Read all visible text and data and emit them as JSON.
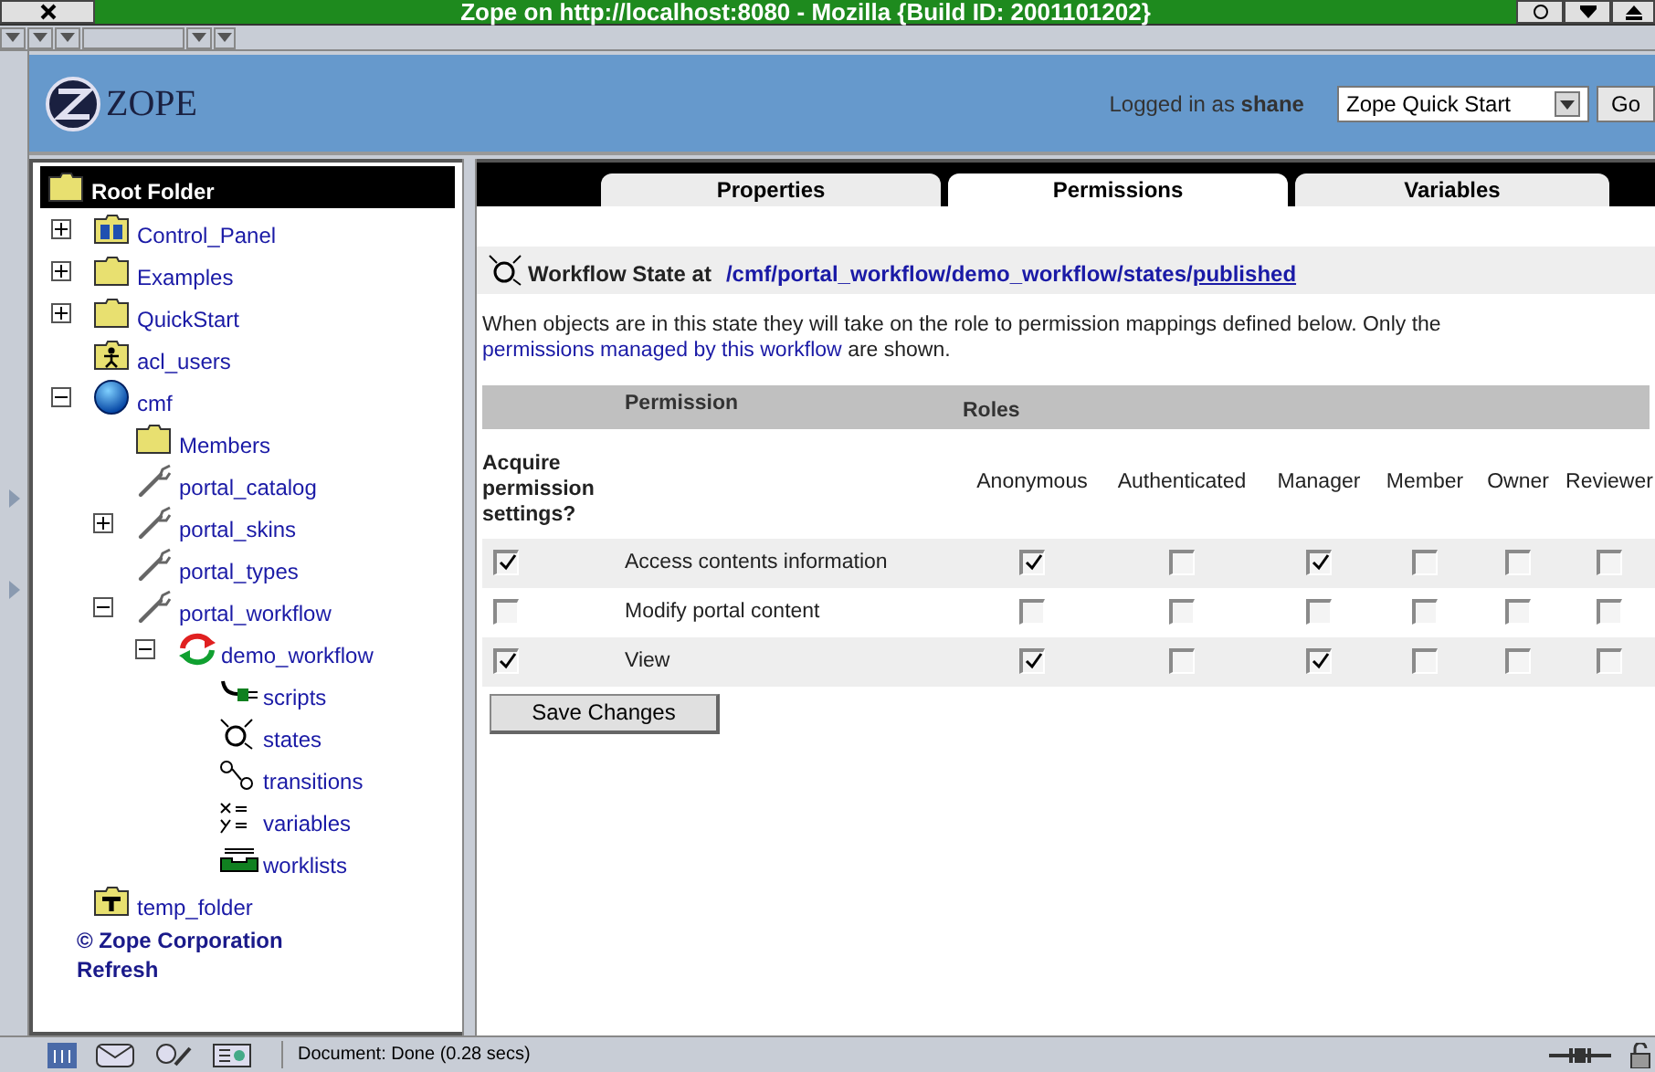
{
  "window": {
    "title": "Zope on http://localhost:8080 - Mozilla {Build ID: 2001101202}"
  },
  "header": {
    "logo": "ZOPE",
    "login": "Logged in as **shane**",
    "select_value": "Zope Quick Start",
    "go_button": "Go"
  },
  "tree": {
    "root": "Root Folder",
    "items": [
      {
        "label": "Control_Panel",
        "kind": "control-panel",
        "expanded": false
      },
      {
        "label": "Examples",
        "kind": "folder",
        "expanded": false
      },
      {
        "label": "QuickStart",
        "kind": "folder",
        "expanded": false
      },
      {
        "label": "acl_users",
        "kind": "user-folder"
      },
      {
        "label": "cmf",
        "kind": "site",
        "expanded": true,
        "children": [
          {
            "label": "Members",
            "kind": "folder"
          },
          {
            "label": "portal_catalog",
            "kind": "tool"
          },
          {
            "label": "portal_skins",
            "kind": "tool",
            "expanded": false
          },
          {
            "label": "portal_types",
            "kind": "tool"
          },
          {
            "label": "portal_workflow",
            "kind": "tool",
            "expanded": true,
            "children": [
              {
                "label": "demo_workflow",
                "kind": "workflow",
                "expanded": true,
                "children": [
                  {
                    "label": "scripts",
                    "kind": "scripts"
                  },
                  {
                    "label": "states",
                    "kind": "states"
                  },
                  {
                    "label": "transitions",
                    "kind": "transitions"
                  },
                  {
                    "label": "variables",
                    "kind": "variables"
                  },
                  {
                    "label": "worklists",
                    "kind": "worklists"
                  }
                ]
              }
            ]
          }
        ]
      },
      {
        "label": "temp_folder",
        "kind": "temp-folder"
      }
    ],
    "links": [
      "© Zope Corporation",
      "Refresh"
    ]
  },
  "tabs": [
    {
      "label": "Properties",
      "selected": false
    },
    {
      "label": "Permissions",
      "selected": true
    },
    {
      "label": "Variables",
      "selected": false
    }
  ],
  "heading": {
    "label": "Workflow State at",
    "path": [
      {
        "text": "/cmf/portal_workflow/demo_workflow/states/",
        "underlined": false
      },
      {
        "text": "published",
        "underlined": true
      }
    ]
  },
  "description": {
    "before": "When objects are in this state they will take on the role to permission mappings defined below. Only the",
    "link": "permissions managed by this workflow",
    "after": "are shown."
  },
  "table": {
    "permission_heading": "Permission",
    "roles_heading": "Roles",
    "acquire_heading": "Acquire permission settings?",
    "roles": [
      "Anonymous",
      "Authenticated",
      "Manager",
      "Member",
      "Owner",
      "Reviewer"
    ],
    "rows": [
      {
        "acquire": true,
        "permission": "Access contents information",
        "grants": [
          true,
          false,
          true,
          false,
          false,
          false
        ]
      },
      {
        "acquire": false,
        "permission": "Modify portal content",
        "grants": [
          false,
          false,
          false,
          false,
          false,
          false
        ]
      },
      {
        "acquire": true,
        "permission": "View",
        "grants": [
          true,
          false,
          true,
          false,
          false,
          false
        ]
      }
    ]
  },
  "save_button": "Save Changes",
  "status_bar": {
    "text": "Document: Done (0.28 secs)"
  }
}
